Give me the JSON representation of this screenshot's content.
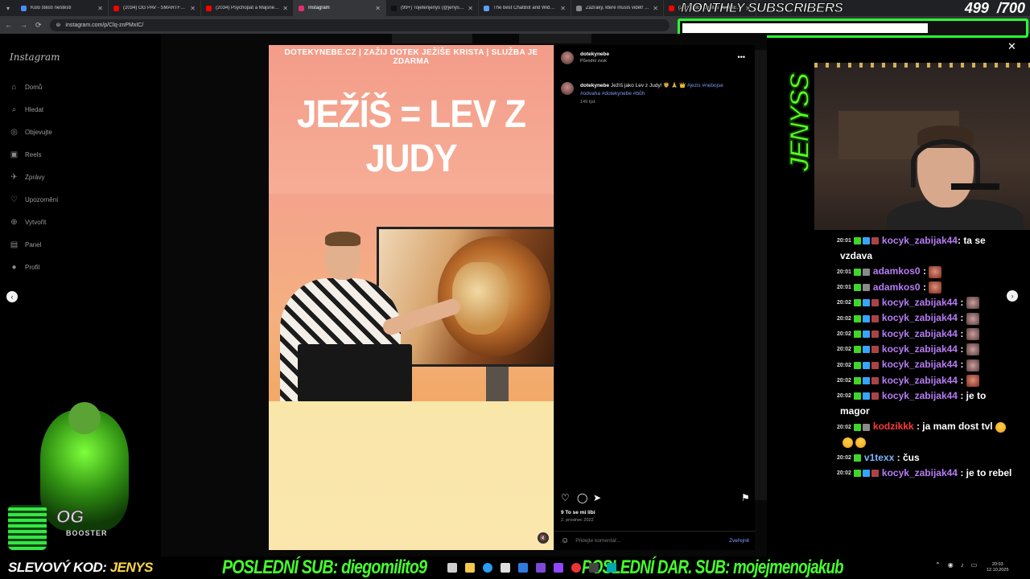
{
  "browser": {
    "tabs": [
      {
        "title": "Kolo štěstí neštěstí",
        "color": "#4c8bf5",
        "active": false
      },
      {
        "title": "(2034) OG PAV - SMARTFELL...",
        "color": "#ff0000",
        "active": false
      },
      {
        "title": "(2034) Psychopat a Majsner vy...",
        "color": "#ff0000",
        "active": false
      },
      {
        "title": "Instagram",
        "color": "#e1306c",
        "active": true
      },
      {
        "title": "(99+) Tojetenjenys (@jenysm...",
        "color": "#111111",
        "active": false
      },
      {
        "title": "The best ChatBot and Widge...",
        "color": "#5aa0ff",
        "active": false
      },
      {
        "title": "Zázraky, které musíš vidět! - ...",
        "color": "#888888",
        "active": false
      },
      {
        "title": "(2034) SETKÁNÍ S JEŽÍŠEM pře...",
        "color": "#ff0000",
        "active": false
      }
    ],
    "url": "instagram.com/p/Clq-znPMxIC/"
  },
  "subs_overlay": {
    "title": "MONTHLY SUBSCRIBERS",
    "current": "499",
    "goal": "/700",
    "progress": 0.713
  },
  "sidebar": {
    "logo": "Instagram",
    "items": [
      {
        "label": "Domů",
        "icon": "home-icon",
        "glyph": "⌂"
      },
      {
        "label": "Hledat",
        "icon": "search-icon",
        "glyph": "⌕"
      },
      {
        "label": "Objevujte",
        "icon": "compass-icon",
        "glyph": "◎"
      },
      {
        "label": "Reels",
        "icon": "reels-icon",
        "glyph": "▣"
      },
      {
        "label": "Zprávy",
        "icon": "messages-icon",
        "glyph": "✈"
      },
      {
        "label": "Upozornění",
        "icon": "heart-icon",
        "glyph": "♡"
      },
      {
        "label": "Vytvořit",
        "icon": "create-icon",
        "glyph": "⊕"
      },
      {
        "label": "Panel",
        "icon": "dashboard-icon",
        "glyph": "▤"
      },
      {
        "label": "Profil",
        "icon": "profile-icon",
        "glyph": "●"
      }
    ]
  },
  "post": {
    "banner": "DOTEKYNEBE.CZ | ZAŽIJ DOTEK JEŽÍŠE KRISTA | SLUŽBA JE ZDARMA",
    "headline": "JEŽÍŠ = LEV Z JUDY",
    "username": "dotekynebe",
    "audio": "Původní zvuk",
    "caption": "Ježíš jako Lev z Judy! 🦁 🙏 👑",
    "tags": "#jezis #nebojse #odvaha #dotekynebe #bůh",
    "time_ago": "149 týd.",
    "likes": "9 To se mi líbí",
    "date": "2. prosinec 2022",
    "comment_placeholder": "Přidejte komentář...",
    "post_label": "Zveřejnit"
  },
  "chat": [
    {
      "time": "20:01",
      "badges": [
        "k",
        "cube",
        "pic"
      ],
      "user": "kocyk_zabijak44",
      "color": "#b77cf5",
      "text": ": ta se",
      "cont": "vzdava",
      "emote": ""
    },
    {
      "time": "20:01",
      "badges": [
        "k",
        "mod"
      ],
      "user": "adamkos0",
      "color": "#b77cf5",
      "text": " :",
      "cont": "",
      "emote": "face"
    },
    {
      "time": "20:01",
      "badges": [
        "k",
        "mod"
      ],
      "user": "adamkos0",
      "color": "#b77cf5",
      "text": " :",
      "cont": "",
      "emote": "face"
    },
    {
      "time": "20:02",
      "badges": [
        "k",
        "cube",
        "pic"
      ],
      "user": "kocyk_zabijak44",
      "color": "#b77cf5",
      "text": " :",
      "cont": "",
      "emote": "cat"
    },
    {
      "time": "20:02",
      "badges": [
        "k",
        "cube",
        "pic"
      ],
      "user": "kocyk_zabijak44",
      "color": "#b77cf5",
      "text": " :",
      "cont": "",
      "emote": "cat"
    },
    {
      "time": "20:02",
      "badges": [
        "k",
        "cube",
        "pic"
      ],
      "user": "kocyk_zabijak44",
      "color": "#b77cf5",
      "text": " :",
      "cont": "",
      "emote": "cat"
    },
    {
      "time": "20:02",
      "badges": [
        "k",
        "cube",
        "pic"
      ],
      "user": "kocyk_zabijak44",
      "color": "#b77cf5",
      "text": " :",
      "cont": "",
      "emote": "cat"
    },
    {
      "time": "20:02",
      "badges": [
        "k",
        "cube",
        "pic"
      ],
      "user": "kocyk_zabijak44",
      "color": "#b77cf5",
      "text": " :",
      "cont": "",
      "emote": "cat"
    },
    {
      "time": "20:02",
      "badges": [
        "k",
        "cube",
        "pic"
      ],
      "user": "kocyk_zabijak44",
      "color": "#b77cf5",
      "text": " :",
      "cont": "",
      "emote": "face"
    },
    {
      "time": "20:02",
      "badges": [
        "k",
        "cube",
        "pic"
      ],
      "user": "kocyk_zabijak44",
      "color": "#b77cf5",
      "text": " : je to",
      "cont": "magor",
      "emote": ""
    },
    {
      "time": "20:02",
      "badges": [
        "k",
        "mod"
      ],
      "user": "kodzikkk",
      "color": "#ff3b3b",
      "text": " : ja mam dost tvl",
      "cont": "",
      "emote": "laugh3"
    },
    {
      "time": "20:02",
      "badges": [
        "k"
      ],
      "user": "v1texx",
      "color": "#7ab8ff",
      "text": " : čus",
      "cont": "",
      "emote": ""
    },
    {
      "time": "20:02",
      "badges": [
        "k",
        "cube",
        "pic"
      ],
      "user": "kocyk_zabijak44",
      "color": "#b77cf5",
      "text": " : je to rebel",
      "cont": "",
      "emote": ""
    }
  ],
  "stream": {
    "brand_vertical": "JENYSS",
    "mascot_logo": "OG",
    "mascot_sub": "BOOSTER"
  },
  "bottom": {
    "code_label": "SLEVOVÝ KOD:",
    "code_value": "JENYS",
    "last_sub": "POSLEDNÍ SUB: diegomilito9",
    "last_gift": "POSLEDNÍ DAR. SUB: mojejmenojakub"
  },
  "tray": {
    "time": "20:03",
    "date": "12.10.2025"
  }
}
